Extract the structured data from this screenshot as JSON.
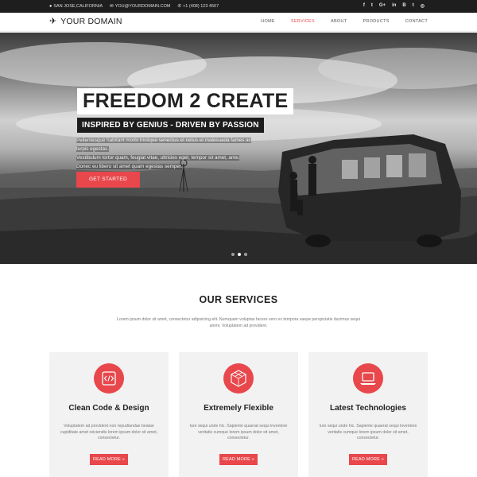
{
  "topbar": {
    "address": "SAN JOSE,CALIFORNIA",
    "email": "YOU@YOURDOMAIN.COM",
    "phone": "+1 (408) 123 4567",
    "social": [
      "f",
      "t",
      "G+",
      "in",
      "B",
      "t",
      "◎"
    ]
  },
  "header": {
    "logo": "YOUR DOMAIN",
    "nav": [
      "HOME",
      "SERVICES",
      "ABOUT",
      "PRODUCTS",
      "CONTACT"
    ],
    "active_index": 1
  },
  "hero": {
    "title": "FREEDOM 2 CREATE",
    "subtitle": "INSPIRED BY GENIUS - DRIVEN BY PASSION",
    "text_lines": [
      "Pellentesque habitant morbi tristique senectus et netus et malesuada fames ac turpis egestas.",
      "Vestibulum tortor quam, feugiat vitae, ultricies eget, tempor sit amet, ante.",
      "Donec eu libero sit amet quam egestas semper."
    ],
    "button": "GET STARTED",
    "slides": 3,
    "active_slide": 1
  },
  "services": {
    "title": "OUR SERVICES",
    "description": "Lorem ipsum dolor sit amet, consectetur adipisicing elit. Numquam voluptas facere vero ex tempora saepe perspiciatis ducimus sequi animi. Voluptatem ad provident.",
    "cards": [
      {
        "icon": "code-icon",
        "title": "Clean Code & Design",
        "text": "Voluptatem ad provident non repudiandae beatae cupiditate amet reiciendis lorem ipsum dolor sit amet, consectetur.",
        "button": "READ MORE »"
      },
      {
        "icon": "hexagon-icon",
        "title": "Extremely Flexible",
        "text": "Iure sequi unde hic. Sapiente quaerat sequi inventore veritatis cumque lorem ipsum dolor sit amet, consectetur.",
        "button": "READ MORE »"
      },
      {
        "icon": "laptop-icon",
        "title": "Latest Technologies",
        "text": "Iure sequi unde hic. Sapiente quaerat sequi inventore veritatis cumque lorem ipsum dolor sit amet, consectetur.",
        "button": "READ MORE »"
      }
    ]
  },
  "colors": {
    "accent": "#e8474b",
    "topbar": "#1e1e1e",
    "card_bg": "#f2f2f2"
  }
}
